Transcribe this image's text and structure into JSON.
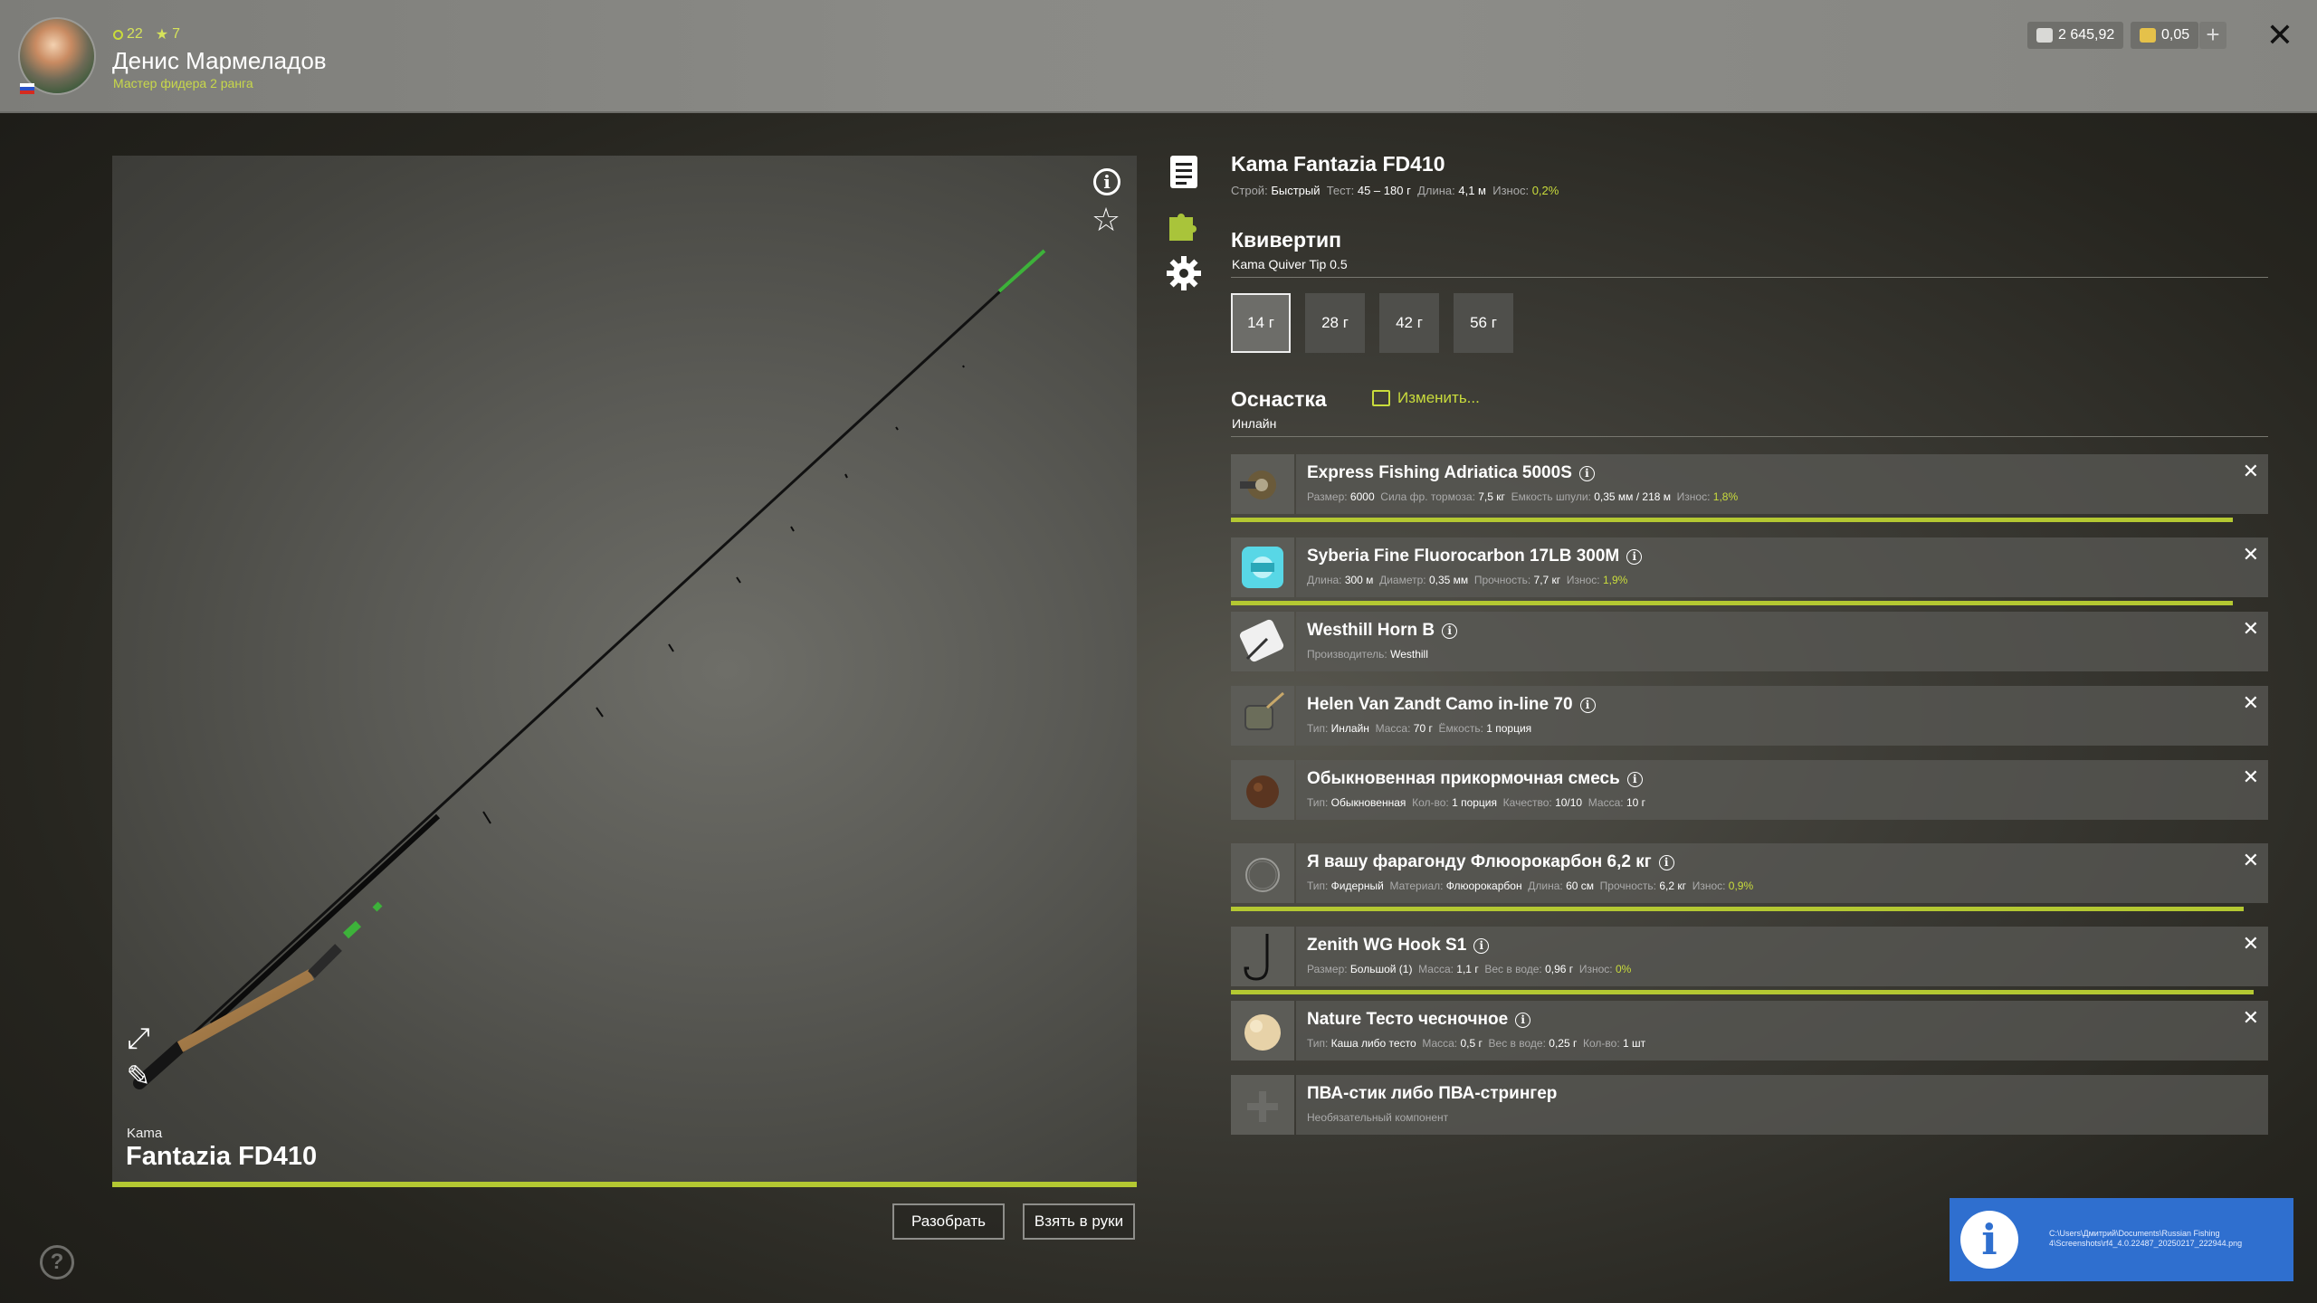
{
  "header": {
    "level": "22",
    "stars": "7",
    "player_name": "Денис Мармеладов",
    "player_rank": "Мастер фидера 2 ранга",
    "silver": "2 645,92",
    "gold": "0,05",
    "plus": "+",
    "close": "✕"
  },
  "viewer": {
    "brand": "Kama",
    "model": "Fantazia FD410",
    "info": "i",
    "star": "☆",
    "expand": "⤢",
    "pen": "✎",
    "disassemble": "Разобрать",
    "take": "Взять в руки",
    "help": "?"
  },
  "rod": {
    "title": "Kama Fantazia FD410",
    "action_label": "Строй:",
    "action": "Быстрый",
    "test_label": "Тест:",
    "test": "45 – 180 г",
    "length_label": "Длина:",
    "length": "4,1 м",
    "wear_label": "Износ:",
    "wear": "0,2%"
  },
  "quiver": {
    "title": "Квивертип",
    "name": "Kama Quiver Tip 0.5",
    "weights": [
      "14 г",
      "28 г",
      "42 г",
      "56 г"
    ],
    "selected_index": 0
  },
  "tackle": {
    "title": "Оснастка",
    "type": "Инлайн",
    "edit": "Изменить..."
  },
  "items": [
    {
      "name": "Express Fishing Adriatica 5000S",
      "props": [
        [
          "Размер:",
          "6000"
        ],
        [
          "Сила фр. тормоза:",
          "7,5 кг"
        ],
        [
          "Емкость шпули:",
          "0,35 мм / 218 м"
        ],
        [
          "Износ:",
          "1,8%"
        ]
      ],
      "wear_fraction": 0.98,
      "icon": "reel-icon"
    },
    {
      "name": "Syberia Fine Fluorocarbon 17LB 300M",
      "props": [
        [
          "Длина:",
          "300 м"
        ],
        [
          "Диаметр:",
          "0,35 мм"
        ],
        [
          "Прочность:",
          "7,7 кг"
        ],
        [
          "Износ:",
          "1,9%"
        ]
      ],
      "wear_fraction": 0.98,
      "icon": "line-spool-icon"
    },
    {
      "name": "Westhill Horn B",
      "props": [
        [
          "Производитель:",
          "Westhill"
        ]
      ],
      "icon": "quiver-tip-icon"
    },
    {
      "name": "Helen Van Zandt Camo in-line 70",
      "props": [
        [
          "Тип:",
          "Инлайн"
        ],
        [
          "Масса:",
          "70 г"
        ],
        [
          "Ёмкость:",
          "1 порция"
        ]
      ],
      "icon": "feeder-icon"
    },
    {
      "name": "Обыкновенная прикормочная смесь",
      "props": [
        [
          "Тип:",
          "Обыкновенная"
        ],
        [
          "Кол-во:",
          "1 порция"
        ],
        [
          "Качество:",
          "10/10"
        ],
        [
          "Масса:",
          "10 г"
        ]
      ],
      "icon": "groundbait-icon"
    },
    {
      "name": "Я вашу фарагонду Флюорокарбон 6,2 кг",
      "props": [
        [
          "Тип:",
          "Фидерный"
        ],
        [
          "Материал:",
          "Флюорокарбон"
        ],
        [
          "Длина:",
          "60 см"
        ],
        [
          "Прочность:",
          "6,2 кг"
        ],
        [
          "Износ:",
          "0,9%"
        ]
      ],
      "wear_fraction": 0.99,
      "icon": "leader-icon"
    },
    {
      "name": "Zenith WG Hook S1",
      "props": [
        [
          "Размер:",
          "Большой (1)"
        ],
        [
          "Масса:",
          "1,1 г"
        ],
        [
          "Вес в воде:",
          "0,96 г"
        ],
        [
          "Износ:",
          "0%"
        ]
      ],
      "wear_fraction": 1.0,
      "icon": "hook-icon"
    },
    {
      "name": "Nature Тесто чесночное",
      "props": [
        [
          "Тип:",
          "Каша либо тесто"
        ],
        [
          "Масса:",
          "0,5 г"
        ],
        [
          "Вес в воде:",
          "0,25 г"
        ],
        [
          "Кол-во:",
          "1 шт"
        ]
      ],
      "icon": "bait-icon"
    },
    {
      "name": "ПВА-стик либо ПВА-стрингер",
      "props": [
        [
          "Необязательный компонент",
          ""
        ]
      ],
      "icon": "add-icon",
      "optional": true
    }
  ],
  "notification": {
    "icon": "i",
    "text": "C:\\Users\\Дмитрий\\Documents\\Russian Fishing 4\\Screenshots\\rf4_4.0.22487_20250217_222944.png"
  }
}
